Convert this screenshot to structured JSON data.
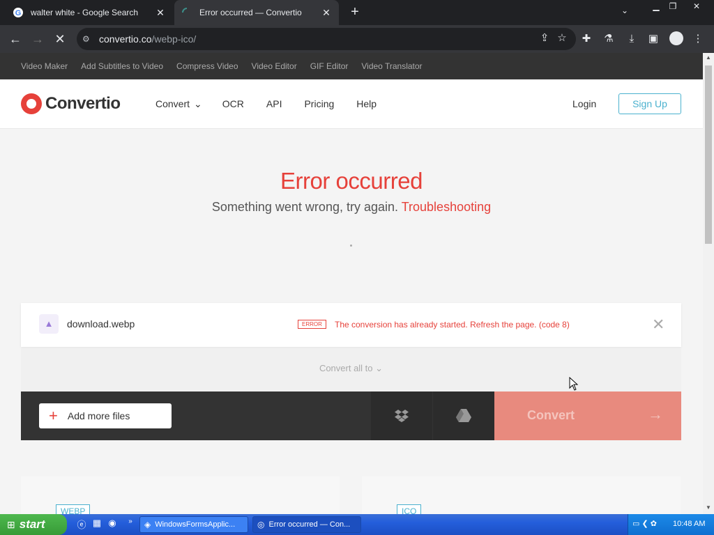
{
  "browser": {
    "tabs": [
      {
        "title": "walter white - Google Search",
        "active": false
      },
      {
        "title": "Error occurred — Convertio",
        "active": true
      }
    ],
    "url_domain": "convertio.co",
    "url_path": "/webp-ico/"
  },
  "subnav": [
    "Video Maker",
    "Add Subtitles to Video",
    "Compress Video",
    "Video Editor",
    "GIF Editor",
    "Video Translator"
  ],
  "header": {
    "logo": "Convertio",
    "nav": [
      "Convert",
      "OCR",
      "API",
      "Pricing",
      "Help"
    ],
    "login": "Login",
    "signup": "Sign Up"
  },
  "error": {
    "title": "Error occurred",
    "subtitle": "Something went wrong, try again.",
    "link": "Troubleshooting"
  },
  "file": {
    "name": "download.webp",
    "badge": "ERROR",
    "message": "The conversion has already started. Refresh the page. (code 8)"
  },
  "convert_all": "Convert all to",
  "actions": {
    "add_files": "Add more files",
    "convert": "Convert"
  },
  "formats": [
    "WEBP",
    "ICO"
  ],
  "taskbar": {
    "start": "start",
    "windows": [
      "WindowsFormsApplic...",
      "Error occurred — Con..."
    ],
    "time": "10:48 AM"
  },
  "colors": {
    "brand_red": "#e6413a",
    "accent_blue": "#4ab1ce"
  }
}
